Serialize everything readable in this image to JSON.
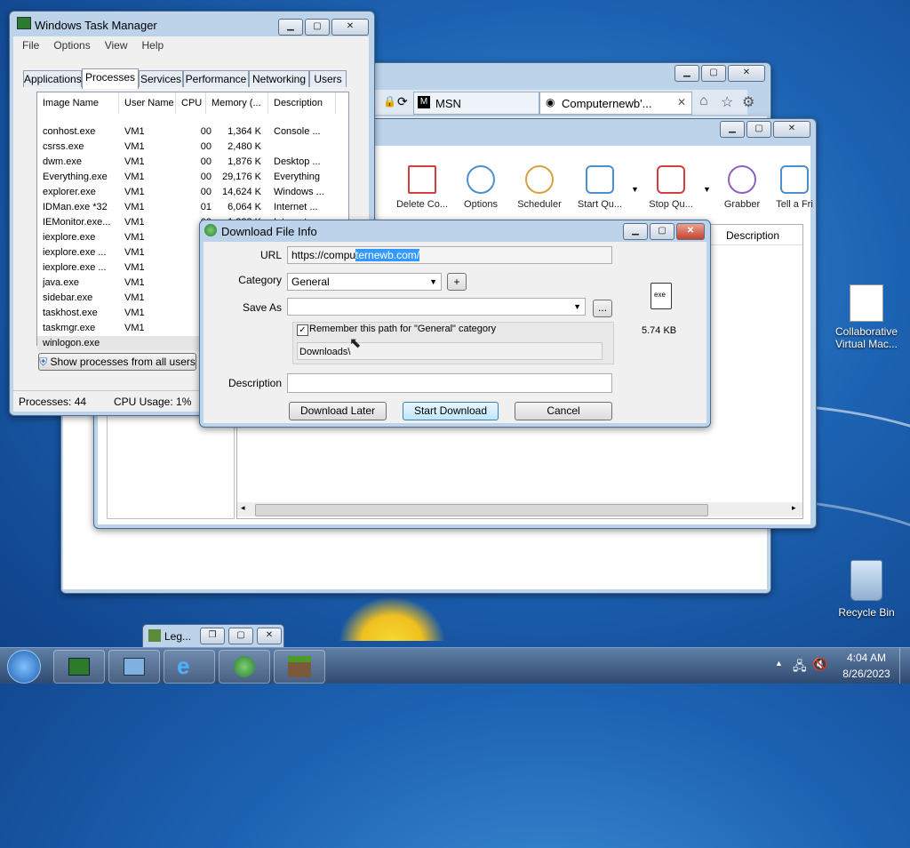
{
  "taskmgr": {
    "title": "Windows Task Manager",
    "menu": [
      "File",
      "Options",
      "View",
      "Help"
    ],
    "tabs": [
      "Applications",
      "Processes",
      "Services",
      "Performance",
      "Networking",
      "Users"
    ],
    "columns": [
      "Image Name",
      "User Name",
      "CPU",
      "Memory (...",
      "Description"
    ],
    "rows": [
      [
        "conhost.exe",
        "VM1",
        "00",
        "1,364 K",
        "Console ..."
      ],
      [
        "csrss.exe",
        "VM1",
        "00",
        "2,480 K",
        ""
      ],
      [
        "dwm.exe",
        "VM1",
        "00",
        "1,876 K",
        "Desktop ..."
      ],
      [
        "Everything.exe",
        "VM1",
        "00",
        "29,176 K",
        "Everything"
      ],
      [
        "explorer.exe",
        "VM1",
        "00",
        "14,624 K",
        "Windows ..."
      ],
      [
        "IDMan.exe *32",
        "VM1",
        "01",
        "6,064 K",
        "Internet ..."
      ],
      [
        "IEMonitor.exe...",
        "VM1",
        "00",
        "1,228 K",
        "Internet ..."
      ],
      [
        "iexplore.exe",
        "VM1",
        "00",
        "",
        ""
      ],
      [
        "iexplore.exe ...",
        "VM1",
        "00",
        "",
        ""
      ],
      [
        "iexplore.exe ...",
        "VM1",
        "00",
        "",
        ""
      ],
      [
        "java.exe",
        "VM1",
        "00",
        "",
        ""
      ],
      [
        "sidebar.exe",
        "VM1",
        "00",
        "",
        ""
      ],
      [
        "taskhost.exe",
        "VM1",
        "00",
        "",
        ""
      ],
      [
        "taskmgr.exe",
        "VM1",
        "00",
        "",
        ""
      ],
      [
        "winlogon.exe",
        "",
        "00",
        "",
        ""
      ]
    ],
    "show_all_button": "Show processes from all users",
    "status_processes": "Processes: 44",
    "status_cpu": "CPU Usage: 1%"
  },
  "browser": {
    "tab1": "MSN",
    "tab2": "Computernewb'...",
    "tab2_close": "✕"
  },
  "idm": {
    "tools": [
      "Delete Co...",
      "Options",
      "Scheduler",
      "Start Qu...",
      "Stop Qu...",
      "Grabber",
      "Tell a Fri"
    ],
    "partial_label": "e",
    "column_description": "Description"
  },
  "dialog": {
    "title": "Download File Info",
    "url_label": "URL",
    "url_plain": "https://compu",
    "url_selected": "ternewb.com/",
    "category_label": "Category",
    "category_value": "General",
    "add_button": "+",
    "saveas_label": "Save As",
    "browse_button": "...",
    "remember_label": "Remember this path for \"General\" category",
    "path_value": "Downloads\\",
    "file_size": "5.74 KB",
    "description_label": "Description",
    "download_later": "Download Later",
    "start_download": "Start Download",
    "cancel": "Cancel"
  },
  "desktop": {
    "icon1": "Collaborative Virtual Mac...",
    "icon2": "Recycle Bin"
  },
  "taskbar": {
    "legacy_window": "Leg...",
    "time": "4:04 AM",
    "date": "8/26/2023"
  }
}
